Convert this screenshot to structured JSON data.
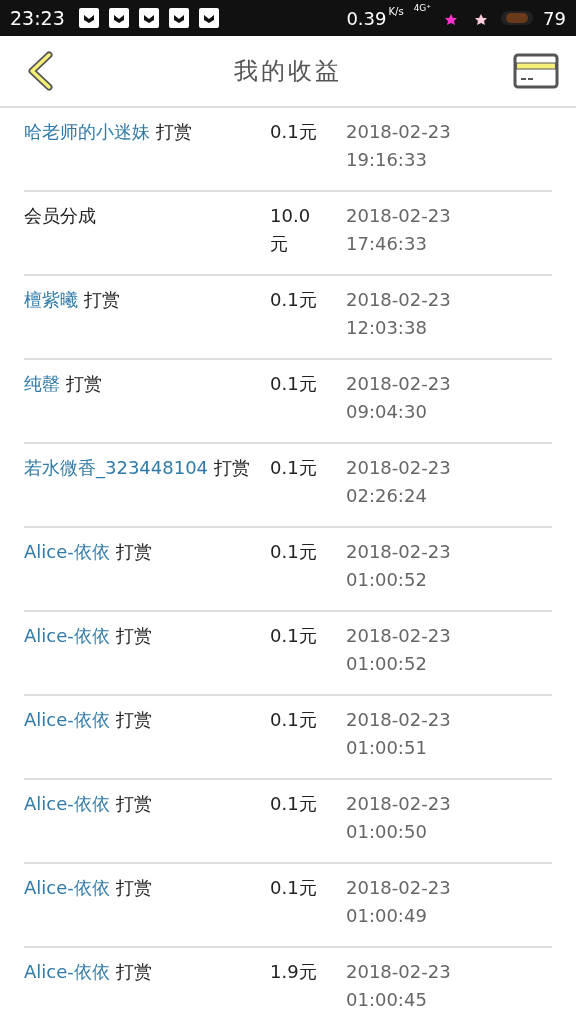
{
  "status_bar": {
    "time": "23:23",
    "speed": "0.39",
    "speed_unit": "K/s",
    "network": "4G⁺",
    "battery": "79"
  },
  "header": {
    "title": "我的收益"
  },
  "rows": [
    {
      "kind": "reward",
      "user": "哈老师的小迷妹",
      "action": "打赏",
      "amount": "0.1元",
      "date": "2018-02-23",
      "time": "19:16:33"
    },
    {
      "kind": "plain",
      "text": "会员分成",
      "amount": "10.0元",
      "date": "2018-02-23",
      "time": "17:46:33"
    },
    {
      "kind": "reward",
      "user": "檀紫曦",
      "action": "打赏",
      "amount": "0.1元",
      "date": "2018-02-23",
      "time": "12:03:38"
    },
    {
      "kind": "reward",
      "user": "纯罄",
      "action": "打赏",
      "amount": "0.1元",
      "date": "2018-02-23",
      "time": "09:04:30"
    },
    {
      "kind": "reward",
      "user": "若水微香_323448104",
      "action": "打赏",
      "amount": "0.1元",
      "date": "2018-02-23",
      "time": "02:26:24"
    },
    {
      "kind": "reward",
      "user": "Alice-依依",
      "action": "打赏",
      "amount": "0.1元",
      "date": "2018-02-23",
      "time": "01:00:52"
    },
    {
      "kind": "reward",
      "user": "Alice-依依",
      "action": "打赏",
      "amount": "0.1元",
      "date": "2018-02-23",
      "time": "01:00:52"
    },
    {
      "kind": "reward",
      "user": "Alice-依依",
      "action": "打赏",
      "amount": "0.1元",
      "date": "2018-02-23",
      "time": "01:00:51"
    },
    {
      "kind": "reward",
      "user": "Alice-依依",
      "action": "打赏",
      "amount": "0.1元",
      "date": "2018-02-23",
      "time": "01:00:50"
    },
    {
      "kind": "reward",
      "user": "Alice-依依",
      "action": "打赏",
      "amount": "0.1元",
      "date": "2018-02-23",
      "time": "01:00:49"
    },
    {
      "kind": "reward",
      "user": "Alice-依依",
      "action": "打赏",
      "amount": "1.9元",
      "date": "2018-02-23",
      "time": "01:00:45"
    }
  ]
}
